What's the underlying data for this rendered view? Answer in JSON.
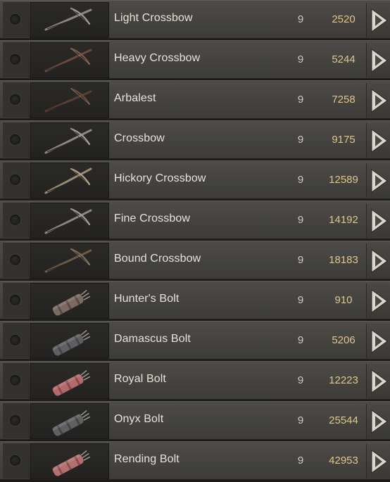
{
  "items": [
    {
      "name": "Light Crossbow",
      "tier": "9",
      "price": "2520",
      "icon": "crossbow-icon"
    },
    {
      "name": "Heavy Crossbow",
      "tier": "9",
      "price": "5244",
      "icon": "crossbow-icon"
    },
    {
      "name": "Arbalest",
      "tier": "9",
      "price": "7258",
      "icon": "crossbow-icon"
    },
    {
      "name": "Crossbow",
      "tier": "9",
      "price": "9175",
      "icon": "crossbow-icon"
    },
    {
      "name": "Hickory Crossbow",
      "tier": "9",
      "price": "12589",
      "icon": "crossbow-icon"
    },
    {
      "name": "Fine Crossbow",
      "tier": "9",
      "price": "14192",
      "icon": "crossbow-icon"
    },
    {
      "name": "Bound Crossbow",
      "tier": "9",
      "price": "18183",
      "icon": "crossbow-icon"
    },
    {
      "name": "Hunter's Bolt",
      "tier": "9",
      "price": "910",
      "icon": "bolt-quiver-icon"
    },
    {
      "name": "Damascus Bolt",
      "tier": "9",
      "price": "5206",
      "icon": "bolt-quiver-icon"
    },
    {
      "name": "Royal Bolt",
      "tier": "9",
      "price": "12223",
      "icon": "bolt-quiver-icon"
    },
    {
      "name": "Onyx Bolt",
      "tier": "9",
      "price": "25544",
      "icon": "bolt-quiver-icon"
    },
    {
      "name": "Rending Bolt",
      "tier": "9",
      "price": "42953",
      "icon": "bolt-quiver-icon"
    }
  ],
  "colors": {
    "price": "#e2c58a",
    "name": "#e7e3da",
    "row_bg": "#45443f"
  }
}
